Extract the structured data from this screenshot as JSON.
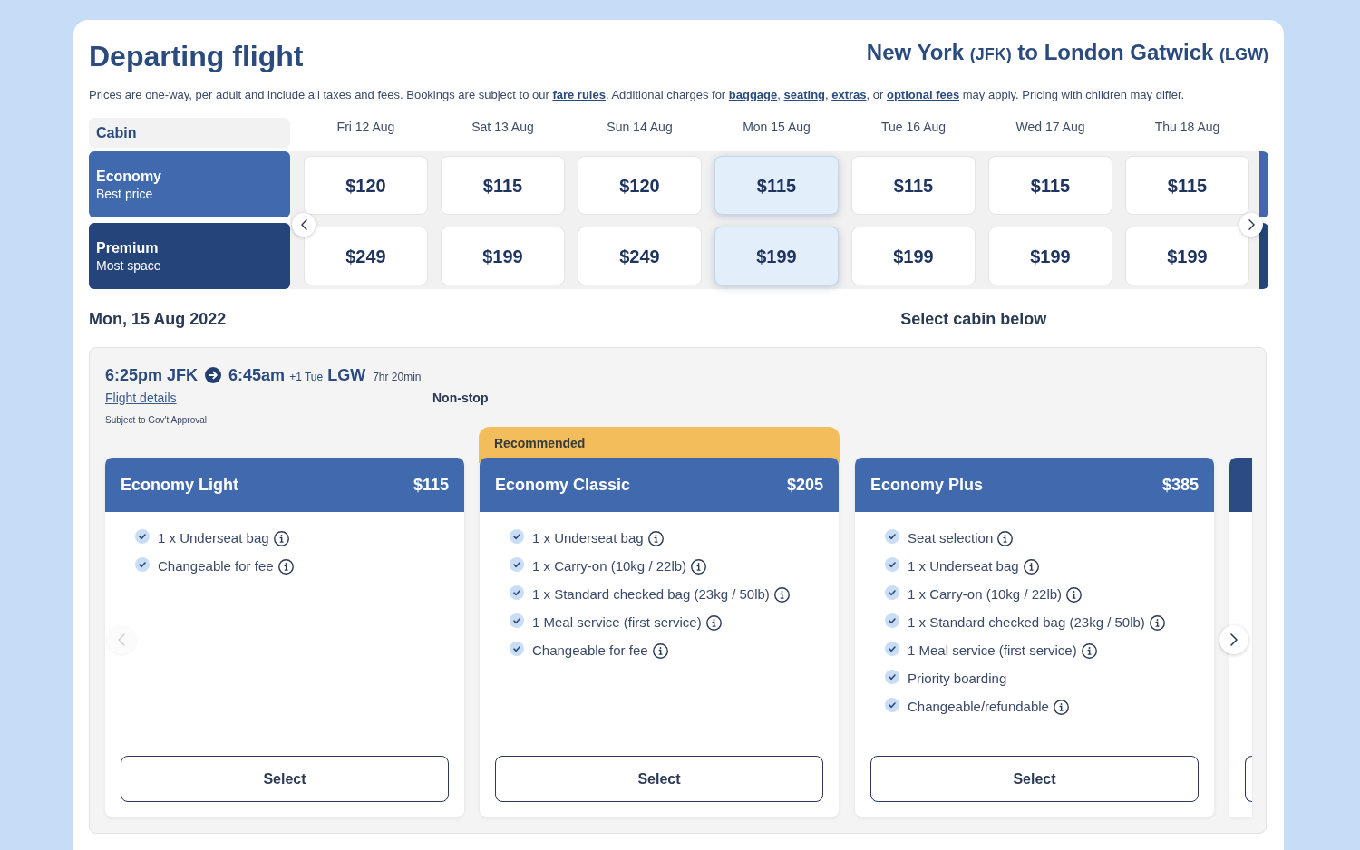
{
  "title": "Departing flight",
  "route": {
    "origin": "New York",
    "origin_code": "(JFK)",
    "joiner": "to",
    "destination": "London Gatwick",
    "destination_code": "(LGW)"
  },
  "notice": [
    {
      "kind": "text",
      "text": "Prices are one-way, per adult and include all taxes and fees. Bookings are subject to our "
    },
    {
      "kind": "link",
      "text": "fare rules"
    },
    {
      "kind": "text",
      "text": ". Additional charges for "
    },
    {
      "kind": "link",
      "text": "baggage"
    },
    {
      "kind": "text",
      "text": ", "
    },
    {
      "kind": "link",
      "text": "seating"
    },
    {
      "kind": "text",
      "text": ", "
    },
    {
      "kind": "link",
      "text": "extras"
    },
    {
      "kind": "text",
      "text": ", or "
    },
    {
      "kind": "link",
      "text": "optional fees"
    },
    {
      "kind": "text",
      "text": " may apply. Pricing with children may differ."
    }
  ],
  "fare_calendar": {
    "cabin_heading": "Cabin",
    "dates": [
      "Fri 12 Aug",
      "Sat 13 Aug",
      "Sun 14 Aug",
      "Mon 15 Aug",
      "Tue 16 Aug",
      "Wed 17 Aug",
      "Thu 18 Aug"
    ],
    "cabins": [
      {
        "name": "Economy",
        "tagline": "Best price",
        "color": "#4169ae",
        "prices": [
          {
            "price": "$120",
            "selected": false
          },
          {
            "price": "$115",
            "selected": false
          },
          {
            "price": "$120",
            "selected": false
          },
          {
            "price": "$115",
            "selected": true
          },
          {
            "price": "$115",
            "selected": false
          },
          {
            "price": "$115",
            "selected": false
          },
          {
            "price": "$115",
            "selected": false
          }
        ]
      },
      {
        "name": "Premium",
        "tagline": "Most space",
        "color": "#24447a",
        "prices": [
          {
            "price": "$249",
            "selected": false
          },
          {
            "price": "$199",
            "selected": false
          },
          {
            "price": "$249",
            "selected": false
          },
          {
            "price": "$199",
            "selected": true
          },
          {
            "price": "$199",
            "selected": false
          },
          {
            "price": "$199",
            "selected": false
          },
          {
            "price": "$199",
            "selected": false
          }
        ]
      }
    ],
    "prev_button": {
      "disabled": false
    },
    "next_button": {
      "disabled": false
    }
  },
  "selected_date": "Mon, 15 Aug 2022",
  "cabin_prompt": "Select cabin below",
  "flight": {
    "departure_time": "6:25pm",
    "departure_airport": "JFK",
    "arrival_time": "6:45am",
    "day_offset": "+1 Tue",
    "arrival_airport": "LGW",
    "duration": "7hr 20min",
    "details_link": "Flight details",
    "stops": "Non-stop",
    "note": "Subject to Gov't Approval"
  },
  "fare_options": {
    "prev_button": {
      "disabled": true
    },
    "next_button": {
      "disabled": false
    },
    "cards": [
      {
        "kind": "full",
        "name": "Economy Light",
        "price": "$115",
        "color": "#4169ae",
        "features": [
          {
            "text": "1 x Underseat bag",
            "included": true,
            "info": true
          },
          {
            "text": "Changeable for fee",
            "included": true,
            "info": true
          }
        ],
        "action": "Select"
      },
      {
        "kind": "full",
        "badge": "Recommended",
        "name": "Economy Classic",
        "price": "$205",
        "color": "#4169ae",
        "features": [
          {
            "text": "1 x Underseat bag",
            "included": true,
            "info": true
          },
          {
            "text": "1 x Carry-on (10kg / 22lb)",
            "included": true,
            "info": true
          },
          {
            "text": "1 x Standard checked bag (23kg / 50lb)",
            "included": true,
            "info": true
          },
          {
            "text": "1 Meal service (first service)",
            "included": true,
            "info": true
          },
          {
            "text": "Changeable for fee",
            "included": true,
            "info": true
          }
        ],
        "action": "Select"
      },
      {
        "kind": "full",
        "name": "Economy Plus",
        "price": "$385",
        "color": "#4169ae",
        "features": [
          {
            "text": "Seat selection",
            "included": true,
            "info": true
          },
          {
            "text": "1 x Underseat bag",
            "included": true,
            "info": true
          },
          {
            "text": "1 x Carry-on (10kg / 22lb)",
            "included": true,
            "info": true
          },
          {
            "text": "1 x Standard checked bag (23kg / 50lb)",
            "included": true,
            "info": true
          },
          {
            "text": "1 Meal service (first service)",
            "included": true,
            "info": true
          },
          {
            "text": "Priority boarding",
            "included": true,
            "info": false
          },
          {
            "text": "Changeable/refundable",
            "included": true,
            "info": true
          }
        ],
        "action": "Select"
      },
      {
        "kind": "partial",
        "color": "#2c4b84"
      }
    ]
  }
}
